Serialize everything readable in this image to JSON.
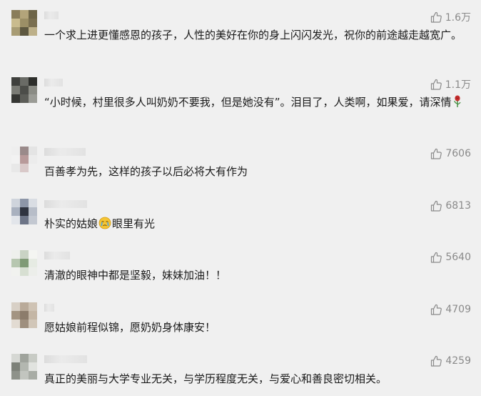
{
  "comments": [
    {
      "likes": "1.6万",
      "text": "一个求上进更懂感恩的孩子，人性的美好在你的身上闪闪发光，祝你的前途越走越宽广。",
      "avatar_colors": [
        "#8a7d5a",
        "#b3a47a",
        "#6e6548",
        "#c9bb8e",
        "#9c8f66",
        "#7a6f50",
        "#a89c74",
        "#5e5840",
        "#bdb089"
      ]
    },
    {
      "likes": "1.1万",
      "text_before": "“小时候，村里很多人叫奶奶不要我，但是她没有”。泪目了，人类啊，如果爱，请深情",
      "emoji_icon": "rose-icon",
      "avatar_colors": [
        "#3f403d",
        "#6a6b66",
        "#2d2e2b",
        "#7a7b75",
        "#4c4d49",
        "#8a8b84",
        "#353633",
        "#5c5d58",
        "#9a9b95"
      ]
    },
    {
      "likes": "7606",
      "text": "百善孝为先，这样的孩子以后必将大有作为",
      "avatar_colors": [
        "#eeeeee",
        "#9a8a8a",
        "#e4e4e4",
        "#f2f2f2",
        "#b89a9a",
        "#ececec",
        "#e8e8e8",
        "#d9c9c9",
        "#f0f0f0"
      ]
    },
    {
      "likes": "6813",
      "text_before": "朴实的姑娘",
      "emoji_icon": "crying-face-icon",
      "text_after": "眼里有光",
      "avatar_colors": [
        "#cfd4dc",
        "#8d96a8",
        "#d9dde3",
        "#a9b1bf",
        "#2f3440",
        "#b7bdc8",
        "#e2e5ea",
        "#6d7587",
        "#c3c8d1"
      ]
    },
    {
      "likes": "5640",
      "text": "清澈的眼神中都是坚毅，妹妹加油！！",
      "avatar_colors": [
        "#eef0ec",
        "#c9d3c4",
        "#f4f5f2",
        "#b7c7b0",
        "#7f9a76",
        "#e6ebe3",
        "#f1f2ef",
        "#d7dfd2",
        "#eceeea"
      ]
    },
    {
      "likes": "4709",
      "text": "愿姑娘前程似锦，愿奶奶身体康安！",
      "avatar_colors": [
        "#d8d0c6",
        "#b9aa99",
        "#cfc3b4",
        "#a39482",
        "#8c7c6b",
        "#c4b6a5",
        "#e2dbd2",
        "#9e8f7e",
        "#d1c6b8"
      ]
    },
    {
      "likes": "4259",
      "text": "真正的美丽与大学专业无关，与学历程度无关，与爱心和善良密切相关。",
      "avatar_colors": [
        "#d6d8d4",
        "#9fa39c",
        "#c8cbc5",
        "#7d8179",
        "#b3b7b0",
        "#e1e3df",
        "#8e928a",
        "#c2c5bf",
        "#a8aca5"
      ]
    }
  ],
  "like_icon": "thumbs-up-outline-icon",
  "colors": {
    "background": "#f0f0f0",
    "meta": "#8a8a8a",
    "text": "#1a1a1a",
    "rose": "#c62d2d",
    "crying_face": "#f5c533"
  }
}
